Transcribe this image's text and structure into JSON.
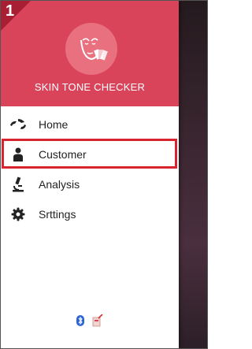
{
  "step": {
    "number": "1"
  },
  "header": {
    "app_title": "SKIN TONE CHECKER",
    "logo_icon": "face-swatch-icon"
  },
  "menu": {
    "items": [
      {
        "label": "Home",
        "icon": "home-icon"
      },
      {
        "label": "Customer",
        "icon": "person-icon"
      },
      {
        "label": "Analysis",
        "icon": "microscope-icon"
      },
      {
        "label": "Srttings",
        "icon": "gear-icon"
      }
    ],
    "highlighted_item": "Customer"
  },
  "footer": {
    "icons": [
      "bluetooth-icon",
      "device-icon"
    ]
  },
  "colors": {
    "header": "#d9445a",
    "highlight": "#d8242f",
    "corner": "#a81f33"
  }
}
